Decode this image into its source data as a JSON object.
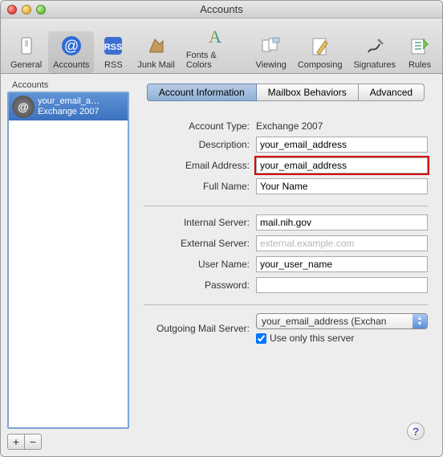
{
  "window": {
    "title": "Accounts"
  },
  "toolbar": {
    "items": [
      {
        "label": "General",
        "icon": "switch-icon"
      },
      {
        "label": "Accounts",
        "icon": "at-icon",
        "selected": true
      },
      {
        "label": "RSS",
        "icon": "rss-icon"
      },
      {
        "label": "Junk Mail",
        "icon": "junk-icon"
      },
      {
        "label": "Fonts & Colors",
        "icon": "font-icon"
      },
      {
        "label": "Viewing",
        "icon": "viewing-icon"
      },
      {
        "label": "Composing",
        "icon": "composing-icon"
      },
      {
        "label": "Signatures",
        "icon": "signatures-icon"
      },
      {
        "label": "Rules",
        "icon": "rules-icon"
      }
    ]
  },
  "sidebar": {
    "title": "Accounts",
    "items": [
      {
        "name": "your_email_a…",
        "type": "Exchange 2007"
      }
    ],
    "add": "+",
    "remove": "−"
  },
  "tabs": {
    "items": [
      {
        "label": "Account Information",
        "selected": true
      },
      {
        "label": "Mailbox Behaviors"
      },
      {
        "label": "Advanced"
      }
    ]
  },
  "form": {
    "account_type_label": "Account Type:",
    "account_type_value": "Exchange 2007",
    "description_label": "Description:",
    "description_value": "your_email_address",
    "email_label": "Email Address:",
    "email_value": "your_email_address",
    "fullname_label": "Full Name:",
    "fullname_value": "Your Name",
    "internal_label": "Internal Server:",
    "internal_value": "mail.nih.gov",
    "external_label": "External Server:",
    "external_placeholder": "external.example.com",
    "username_label": "User Name:",
    "username_value": "your_user_name",
    "password_label": "Password:",
    "password_value": "",
    "outgoing_label": "Outgoing Mail Server:",
    "outgoing_value": "your_email_address (Exchan",
    "use_only_label": "Use only this server",
    "use_only_checked": true
  },
  "help": "?"
}
